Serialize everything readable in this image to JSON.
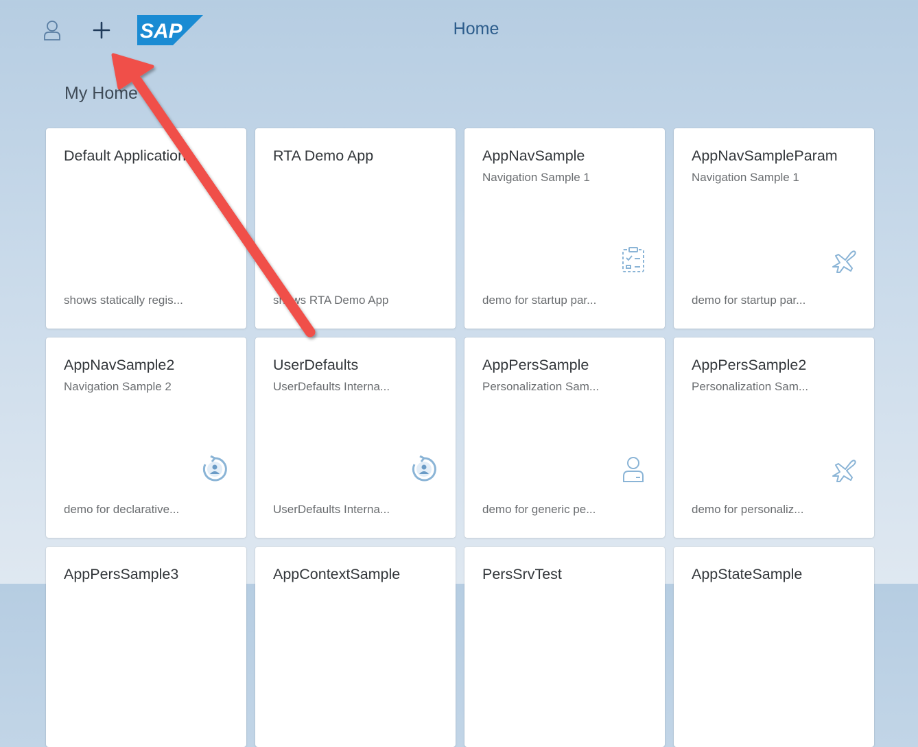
{
  "header": {
    "title": "Home",
    "user_icon": "person-icon",
    "add_icon": "plus-icon",
    "logo_text": "SAP",
    "logo_color": "#1a8bd3"
  },
  "section": {
    "title": "My Home"
  },
  "colors": {
    "icon_color": "#8ab4d6",
    "annotation_arrow": "#f0504a"
  },
  "tiles": [
    {
      "title": "Default Application",
      "subtitle": "",
      "icon": "",
      "footer": "shows statically regis..."
    },
    {
      "title": "RTA Demo App",
      "subtitle": "",
      "icon": "",
      "footer": "shows RTA Demo App"
    },
    {
      "title": "AppNavSample",
      "subtitle": "Navigation Sample 1",
      "icon": "task-checklist-icon",
      "footer": "demo for startup par..."
    },
    {
      "title": "AppNavSampleParam",
      "subtitle": "Navigation Sample 1",
      "icon": "airplane-icon",
      "footer": "demo for startup par..."
    },
    {
      "title": "AppNavSample2",
      "subtitle": "Navigation Sample 2",
      "icon": "user-refresh-icon",
      "footer": "demo for declarative..."
    },
    {
      "title": "UserDefaults",
      "subtitle": "UserDefaults Interna...",
      "icon": "user-refresh-icon",
      "footer": "UserDefaults Interna..."
    },
    {
      "title": "AppPersSample",
      "subtitle": "Personalization Sam...",
      "icon": "employee-icon",
      "footer": "demo for generic pe..."
    },
    {
      "title": "AppPersSample2",
      "subtitle": "Personalization Sam...",
      "icon": "airplane-icon",
      "footer": "demo for personaliz..."
    },
    {
      "title": "AppPersSample3",
      "subtitle": "",
      "icon": "",
      "footer": ""
    },
    {
      "title": "AppContextSample",
      "subtitle": "",
      "icon": "",
      "footer": ""
    },
    {
      "title": "PersSrvTest",
      "subtitle": "",
      "icon": "",
      "footer": ""
    },
    {
      "title": "AppStateSample",
      "subtitle": "",
      "icon": "",
      "footer": ""
    }
  ]
}
